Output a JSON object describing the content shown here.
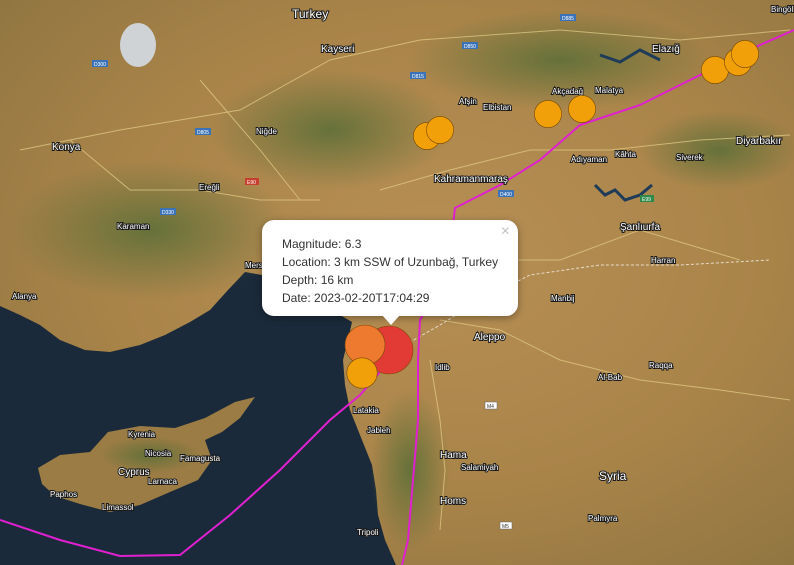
{
  "popup": {
    "magnitude_label": "Magnitude: ",
    "magnitude": "6.3",
    "location_label": "Location: ",
    "location": "3 km SSW of Uzunbağ, Turkey",
    "depth_label": "Depth: ",
    "depth": "16 km",
    "date_label": "Date: ",
    "date": "2023-02-20T17:04:29",
    "close_glyph": "×"
  },
  "map": {
    "country_labels": [
      "Turkey",
      "Syria",
      "Cyprus"
    ],
    "city_labels": [
      "Kayseri",
      "Konya",
      "Kahramanmaraş",
      "Adıyaman",
      "Malatya",
      "Elazığ",
      "Diyarbakır",
      "Şanlıurfa",
      "Aleppo",
      "Latakia",
      "Hama",
      "Homs",
      "Tripoli",
      "Nicosia",
      "Kyrenia",
      "Famagusta",
      "Larnaca",
      "Limassol",
      "Paphos",
      "Mersin",
      "Alanya",
      "Elbistan",
      "Afşin",
      "Niğde",
      "Ereğli",
      "Karaman",
      "Akçadağ",
      "Kâhta",
      "Siverek",
      "Harran",
      "Manbij",
      "Al-Bab",
      "Jableh",
      "Idlib",
      "Bingöl",
      "Raqqa",
      "Salamiyah",
      "Palmyra"
    ],
    "road_shields": [
      "D300",
      "D805",
      "D815",
      "D850",
      "D885",
      "E90",
      "E99",
      "D400",
      "D330",
      "M4",
      "M5"
    ],
    "colors": {
      "fault_line": "#e020d0",
      "marker_orange": "#f2a00a",
      "marker_dark_orange": "#ee7a30",
      "marker_red": "#e23a34",
      "sea": "#1b2a3a"
    }
  },
  "earthquakes": [
    {
      "magnitude": 6.3,
      "category": "red"
    },
    {
      "magnitude": 5.8,
      "category": "dark-orange"
    },
    {
      "magnitude": 5.2,
      "category": "orange"
    },
    {
      "magnitude": 5.0,
      "category": "orange"
    },
    {
      "magnitude": 5.0,
      "category": "orange"
    },
    {
      "magnitude": 5.0,
      "category": "orange"
    },
    {
      "magnitude": 5.0,
      "category": "orange"
    },
    {
      "magnitude": 5.0,
      "category": "orange"
    },
    {
      "magnitude": 5.0,
      "category": "orange"
    },
    {
      "magnitude": 5.0,
      "category": "orange"
    }
  ]
}
